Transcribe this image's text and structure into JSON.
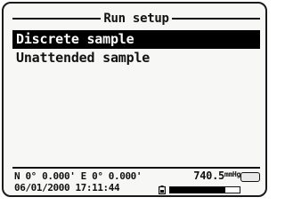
{
  "screen": {
    "title": "Run setup",
    "menu": {
      "items": [
        {
          "label": "Discrete sample",
          "selected": true
        },
        {
          "label": "Unattended sample",
          "selected": false
        }
      ]
    }
  },
  "status": {
    "gps": "N 0° 0.000' E  0° 0.000'",
    "datetime": "06/01/2000 17:11:44",
    "pressure_value": "740.5",
    "pressure_unit": "mmHg",
    "battery_level": 0.8,
    "icons": {
      "battery": "battery-icon",
      "logo": "brand-logo-icon"
    }
  },
  "colors": {
    "selection_bg": "#000000",
    "selection_fg": "#ffffff",
    "screen_bg": "#f7f7f5"
  }
}
